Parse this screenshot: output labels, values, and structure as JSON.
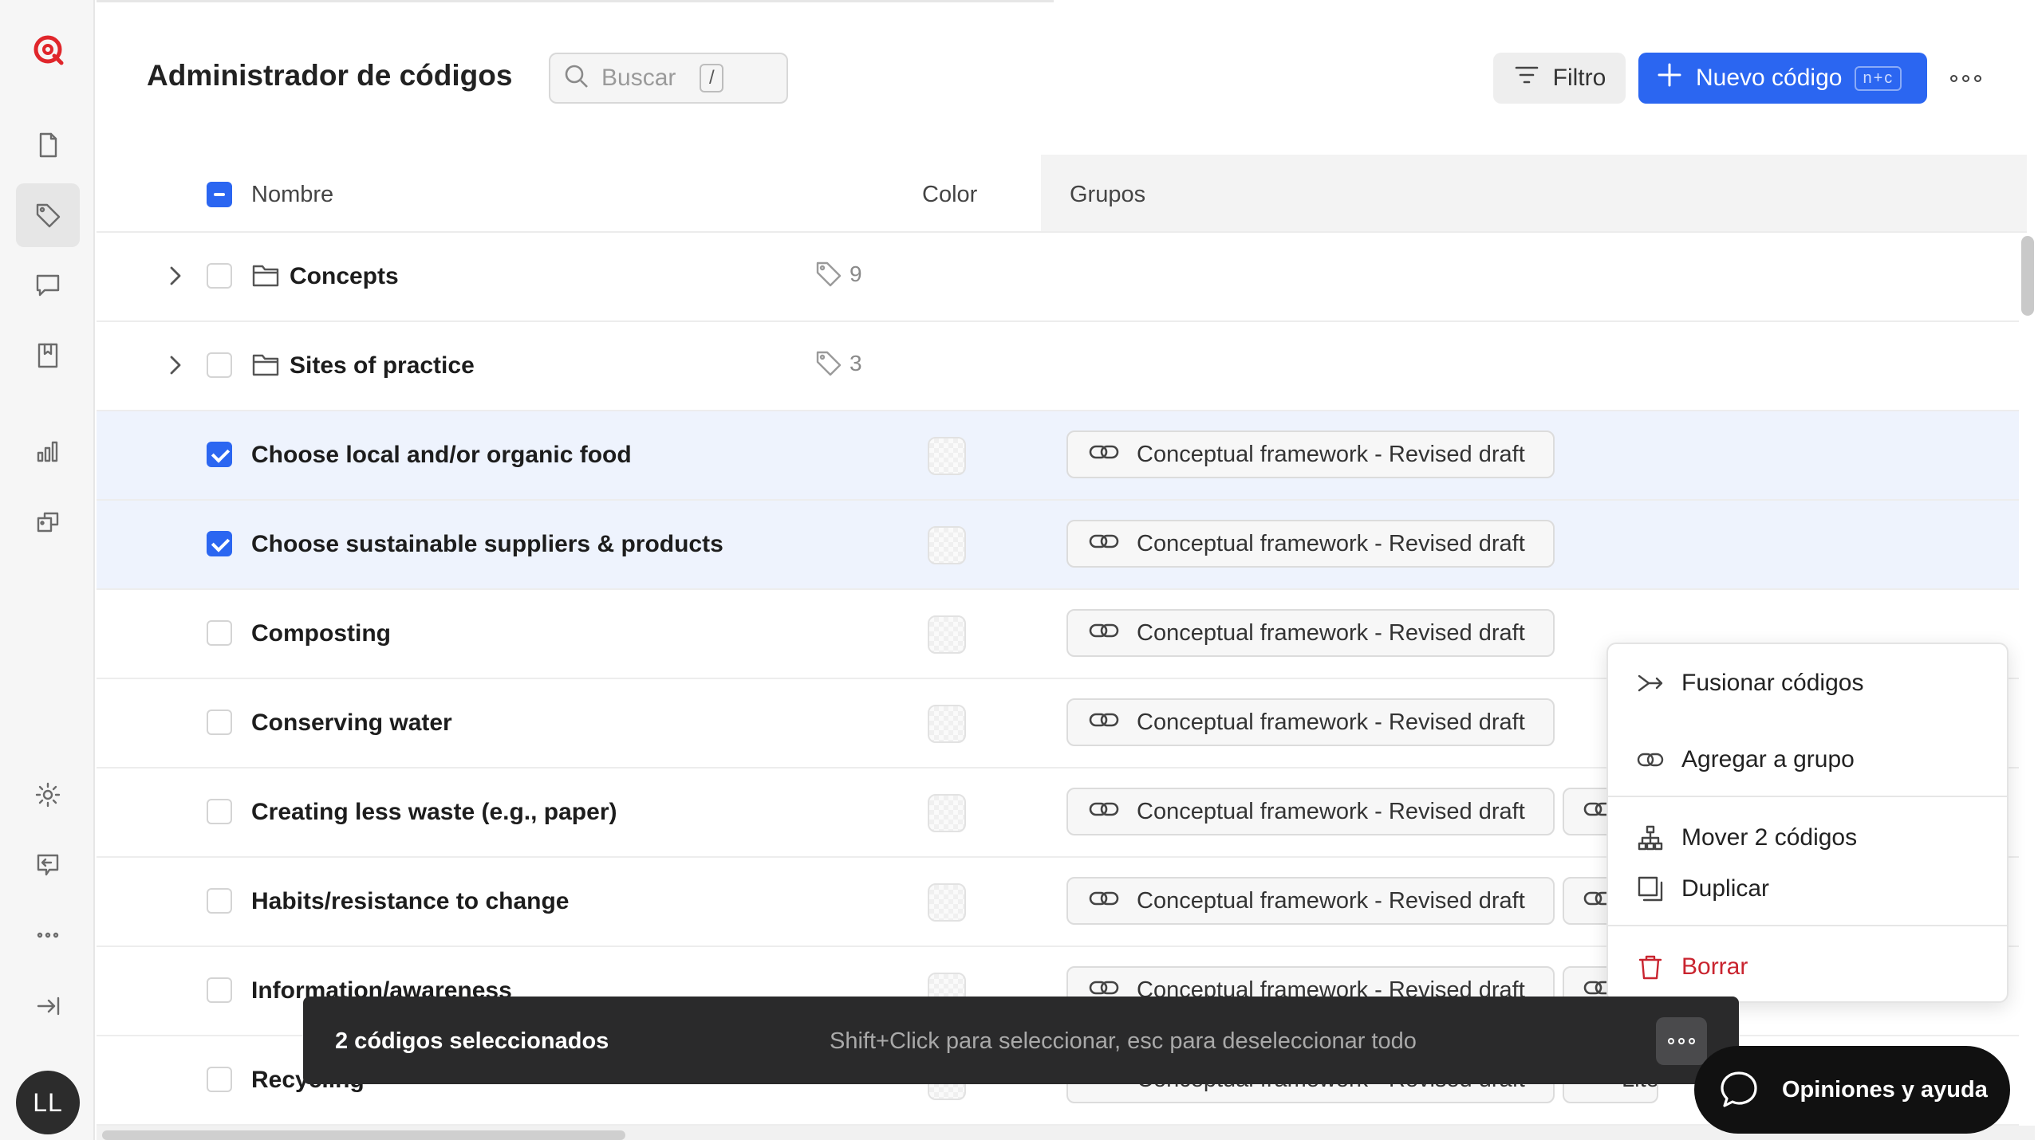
{
  "app": {
    "title": "Administrador de códigos"
  },
  "rail": {
    "avatar_initials": "LL"
  },
  "search": {
    "placeholder": "Buscar",
    "shortcut": "/"
  },
  "toolbar": {
    "filter_label": "Filtro",
    "new_label": "Nuevo código",
    "new_shortcut": "n+c"
  },
  "table": {
    "headers": {
      "name": "Nombre",
      "color": "Color",
      "groups": "Grupos"
    },
    "folders": [
      {
        "name": "Concepts",
        "count": "9"
      },
      {
        "name": "Sites of practice",
        "count": "3"
      }
    ],
    "codes": [
      {
        "name": "Choose local and/or organic food",
        "group": "Conceptual framework - Revised draft",
        "checked": true
      },
      {
        "name": "Choose sustainable suppliers & products",
        "group": "Conceptual framework - Revised draft",
        "checked": true
      },
      {
        "name": "Composting",
        "group": "Conceptual framework - Revised draft",
        "checked": false
      },
      {
        "name": "Conserving water",
        "group": "Conceptual framework - Revised draft",
        "checked": false
      },
      {
        "name": "Creating less waste (e.g., paper)",
        "group": "Conceptual framework - Revised draft",
        "group2": "",
        "checked": false
      },
      {
        "name": "Habits/resistance to change",
        "group": "Conceptual framework - Revised draft",
        "group2": "",
        "checked": false
      },
      {
        "name": "Information/awareness",
        "group": "Conceptual framework - Revised draft",
        "group2": "",
        "checked": false
      },
      {
        "name": "Recycling",
        "group": "Conceptual framework - Revised draft",
        "group2": "Litera",
        "checked": false
      }
    ]
  },
  "context_menu": {
    "merge": "Fusionar códigos",
    "add_group": "Agregar a grupo",
    "move": "Mover 2 códigos",
    "duplicate": "Duplicar",
    "delete": "Borrar"
  },
  "selection_bar": {
    "count": "2 códigos seleccionados",
    "hint": "Shift+Click para seleccionar, esc para deseleccionar todo"
  },
  "feedback": {
    "label": "Opiniones y ayuda"
  },
  "colors": {
    "accent": "#2b66f1",
    "danger": "#c9242f",
    "brand": "#e0262b",
    "bar": "#2a2a2b"
  }
}
